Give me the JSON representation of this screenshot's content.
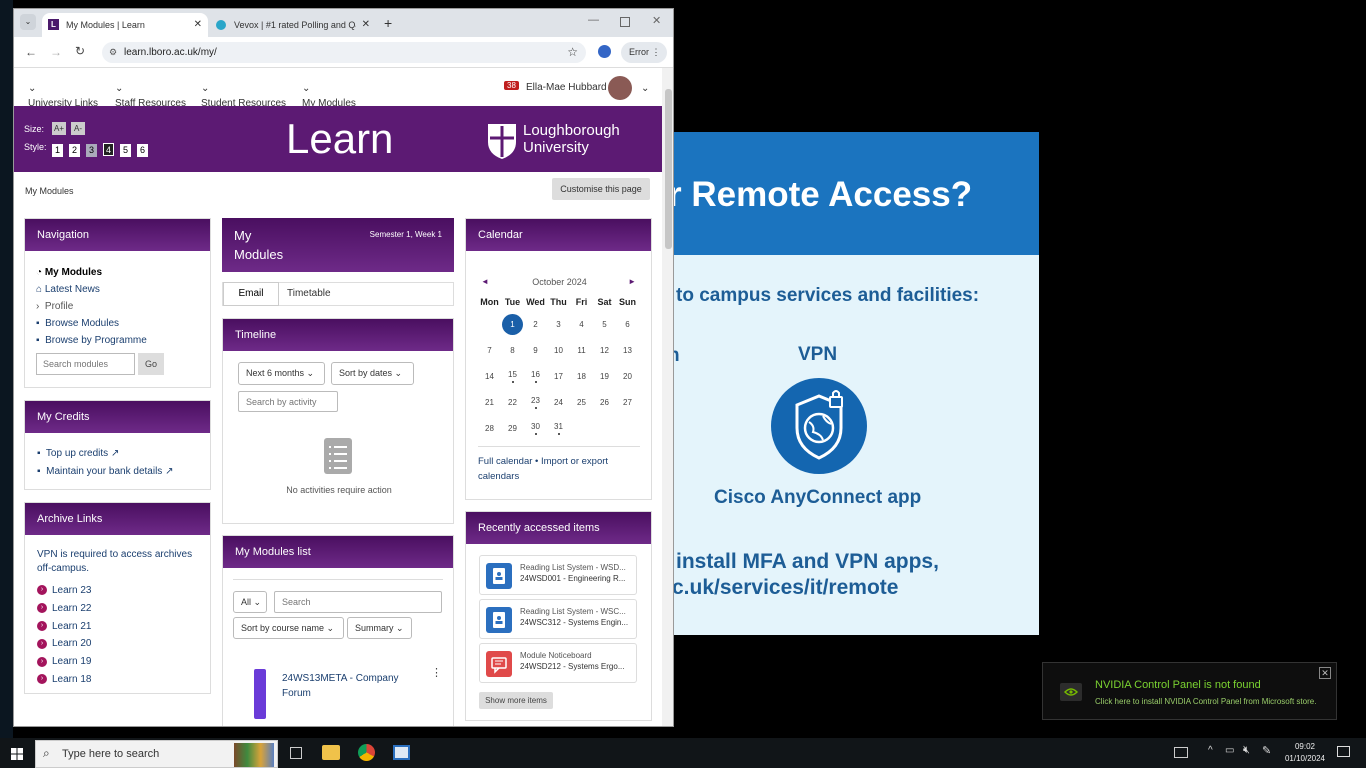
{
  "browser": {
    "tabs": [
      {
        "title": "My Modules | Learn",
        "favicon": "L"
      },
      {
        "title": "Vevox | #1 rated Polling and Q&"
      }
    ],
    "url": "learn.lboro.ac.uk/my/",
    "error_label": "Error"
  },
  "topnav": {
    "items": [
      "University Links",
      "Staff Resources",
      "Student Resources",
      "My Modules"
    ],
    "notif_count": "38",
    "user_name": "Ella-Mae Hubbard"
  },
  "banner": {
    "size_label": "Size:",
    "size_buttons": [
      "A+",
      "A-"
    ],
    "style_label": "Style:",
    "style_buttons": [
      "1",
      "2",
      "3",
      "4",
      "5",
      "6"
    ],
    "title": "Learn",
    "uni_line1": "Loughborough",
    "uni_line2": "University"
  },
  "breadcrumb": "My Modules",
  "customise_button": "Customise this page",
  "navigation": {
    "title": "Navigation",
    "items": [
      "My Modules",
      "Latest News",
      "Profile",
      "Browse Modules",
      "Browse by Programme"
    ],
    "search_placeholder": "Search modules",
    "go": "Go"
  },
  "credits": {
    "title": "My Credits",
    "items": [
      "Top up credits",
      "Maintain your bank details"
    ]
  },
  "archive": {
    "title": "Archive Links",
    "note": "VPN is required to access archives off-campus.",
    "items": [
      "Learn 23",
      "Learn 22",
      "Learn 21",
      "Learn 20",
      "Learn 19",
      "Learn 18"
    ]
  },
  "my_modules": {
    "title_line1": "My",
    "title_line2": "Modules",
    "semester": "Semester 1, Week 1",
    "tabs": [
      "Email",
      "Timetable"
    ]
  },
  "timeline": {
    "title": "Timeline",
    "range": "Next 6 months",
    "sort": "Sort by dates",
    "search_placeholder": "Search by activity",
    "empty": "No activities require action"
  },
  "modules_list": {
    "title": "My Modules list",
    "filter": "All",
    "search_placeholder": "Search",
    "sort": "Sort by course name",
    "view": "Summary",
    "course_line1": "24WS13META - Company",
    "course_line2": "Forum"
  },
  "calendar": {
    "title": "Calendar",
    "month": "October 2024",
    "days": [
      "Mon",
      "Tue",
      "Wed",
      "Thu",
      "Fri",
      "Sat",
      "Sun"
    ],
    "weeks": [
      [
        "",
        "1",
        "2",
        "3",
        "4",
        "5",
        "6"
      ],
      [
        "7",
        "8",
        "9",
        "10",
        "11",
        "12",
        "13"
      ],
      [
        "14",
        "15",
        "16",
        "17",
        "18",
        "19",
        "20"
      ],
      [
        "21",
        "22",
        "23",
        "24",
        "25",
        "26",
        "27"
      ],
      [
        "28",
        "29",
        "30",
        "31",
        "",
        "",
        ""
      ]
    ],
    "today": "1",
    "event_days": [
      "15",
      "16",
      "23",
      "30",
      "31"
    ],
    "full_calendar": "Full calendar",
    "separator": "•",
    "import_export": "Import or export calendars"
  },
  "recent": {
    "title": "Recently accessed items",
    "items": [
      {
        "line1": "Reading List System - WSD...",
        "line2": "24WSD001 - Engineering R...",
        "color": "#2b6fbf"
      },
      {
        "line1": "Reading List System - WSC...",
        "line2": "24WSC312 - Systems Engin...",
        "color": "#2b6fbf"
      },
      {
        "line1": "Module Noticeboard",
        "line2": "24WSD212 - Systems Ergo...",
        "color": "#e04a4a"
      }
    ],
    "show_more": "Show more items"
  },
  "slide": {
    "title": "r Remote Access?",
    "subtitle": "to campus services and facilities:",
    "fragment": "n",
    "vpn": "VPN",
    "app": "Cisco AnyConnect app",
    "line1": "install MFA and VPN apps,",
    "line2": "c.uk/services/it/remote"
  },
  "toast": {
    "title": "NVIDIA Control Panel is not found",
    "body": "Click here to install NVIDIA Control Panel from Microsoft store."
  },
  "taskbar": {
    "search_placeholder": "Type here to search",
    "time": "09:02",
    "date": "01/10/2024"
  }
}
